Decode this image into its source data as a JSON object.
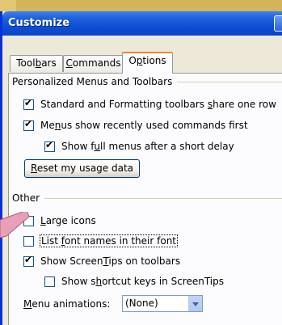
{
  "window": {
    "title": "Customize"
  },
  "tabs": [
    {
      "label": "Toolbars",
      "active": false
    },
    {
      "label": "Commands",
      "active": false
    },
    {
      "label": "Options",
      "active": true
    }
  ],
  "options": {
    "group1_label": "Personalized Menus and Toolbars",
    "std_format_share_row": {
      "label": "Standard and Formatting toolbars share one row",
      "checked": true
    },
    "menus_recent_first": {
      "label": "Menus show recently used commands first",
      "checked": true
    },
    "full_menus_delay": {
      "label": "Show full menus after a short delay",
      "checked": true
    },
    "reset_button": "Reset my usage data",
    "group2_label": "Other",
    "large_icons": {
      "label": "Large icons",
      "checked": false
    },
    "font_names": {
      "label": "List font names in their font",
      "checked": false
    },
    "screentips": {
      "label": "Show ScreenTips on toolbars",
      "checked": true
    },
    "shortcut_keys": {
      "label": "Show shortcut keys in ScreenTips",
      "checked": false
    },
    "menu_animations_label": "Menu animations:",
    "menu_animations_value": "(None)"
  },
  "colors": {
    "accent_title": "#0a4dd3",
    "background_page": "#d4b35a",
    "dialog_bg": "#ece9d8",
    "callout": "#e8a0b8"
  }
}
